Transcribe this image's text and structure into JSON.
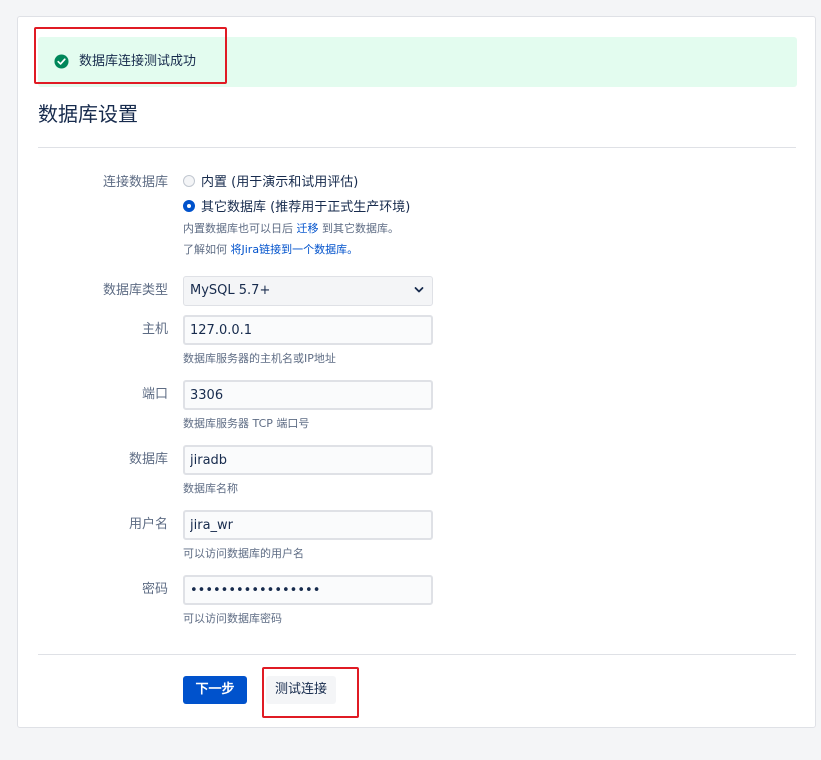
{
  "banner": {
    "icon": "check-circle-icon",
    "message": "数据库连接测试成功",
    "color": "#00875a",
    "background": "#e3fcef"
  },
  "page": {
    "title": "数据库设置"
  },
  "connection": {
    "label": "连接数据库",
    "options": [
      {
        "label": "内置 (用于演示和试用评估)",
        "selected": false
      },
      {
        "label": "其它数据库 (推荐用于正式生产环境)",
        "selected": true
      }
    ],
    "help1_prefix": "内置数据库也可以日后 ",
    "help1_link": "迁移",
    "help1_suffix": " 到其它数据库。",
    "help2_prefix": "了解如何 ",
    "help2_link": "将Jira链接到一个数据库。"
  },
  "db_type": {
    "label": "数据库类型",
    "value": "MySQL 5.7+"
  },
  "host": {
    "label": "主机",
    "value": "127.0.0.1",
    "help": "数据库服务器的主机名或IP地址"
  },
  "port": {
    "label": "端口",
    "value": "3306",
    "help": "数据库服务器 TCP 端口号"
  },
  "database": {
    "label": "数据库",
    "value": "jiradb",
    "help": "数据库名称"
  },
  "username": {
    "label": "用户名",
    "value": "jira_wr",
    "help": "可以访问数据库的用户名"
  },
  "password": {
    "label": "密码",
    "value": "•••••••••••••••••",
    "help": "可以访问数据库密码"
  },
  "buttons": {
    "next": "下一步",
    "test": "测试连接"
  },
  "colors": {
    "primary": "#0052cc",
    "highlight": "#e01b24"
  }
}
